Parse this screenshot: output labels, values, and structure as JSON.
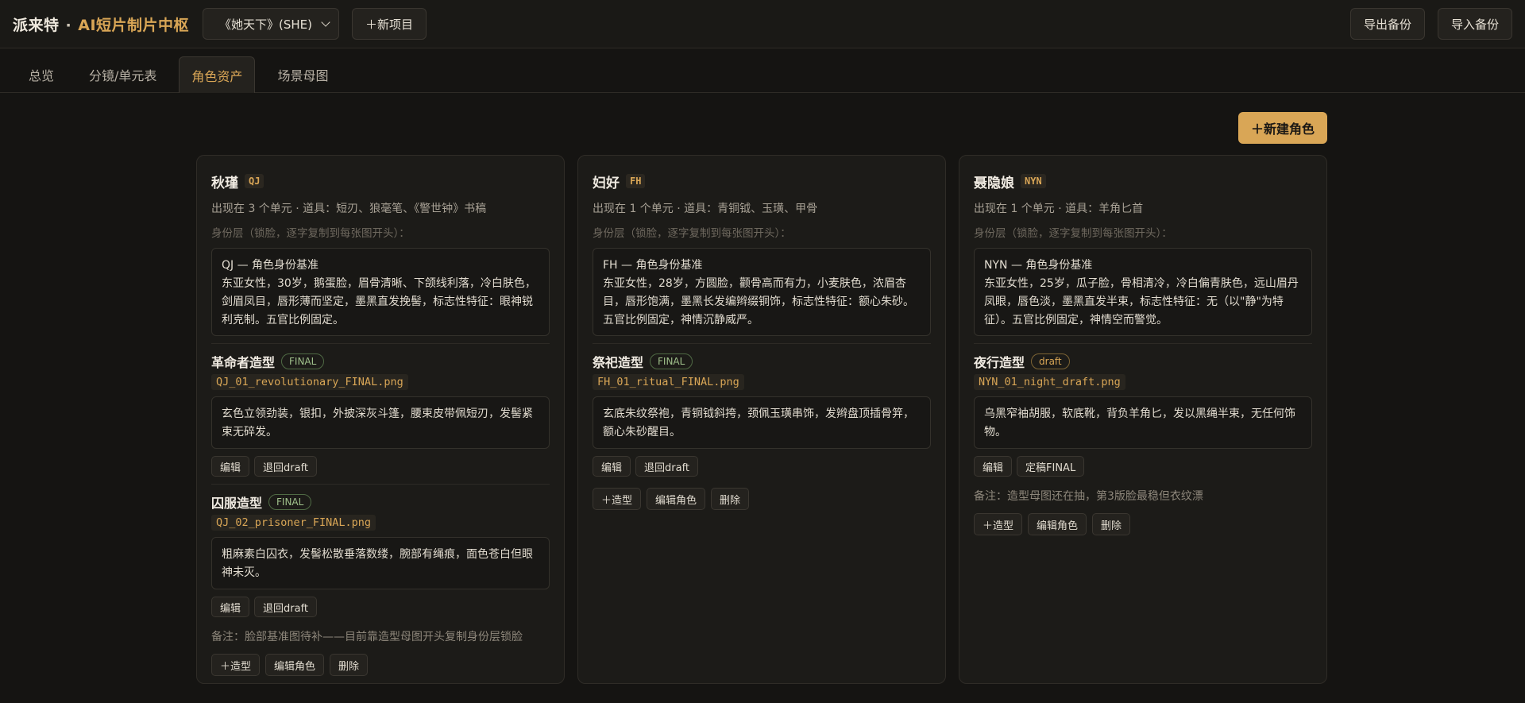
{
  "header": {
    "brand_name": "派来特",
    "brand_sep": "·",
    "brand_suffix": "AI短片制片中枢",
    "project": "《她天下》(SHE)",
    "new_project": "＋新项目",
    "export": "导出备份",
    "import": "导入备份"
  },
  "tabs": [
    {
      "label": "总览"
    },
    {
      "label": "分镜/单元表"
    },
    {
      "label": "角色资产"
    },
    {
      "label": "场景母图"
    }
  ],
  "toolbar": {
    "new_character": "＋新建角色"
  },
  "characters": [
    {
      "name": "秋瑾",
      "code": "QJ",
      "meta": "出现在 3 个单元 · 道具：短刃、狼毫笔、《警世钟》书稿",
      "hint": "身份层（锁脸，逐字复制到每张图开头）：",
      "identity_title": "QJ — 角色身份基准",
      "identity_body": "东亚女性，30岁，鹅蛋脸，眉骨清晰、下颌线利落，冷白肤色，剑眉凤目，唇形薄而坚定，墨黑直发挽髻，标志性特征：眼神锐利克制。五官比例固定。",
      "looks": [
        {
          "name": "革命者造型",
          "status": "FINAL",
          "file": "QJ_01_revolutionary_FINAL.png",
          "desc": "玄色立领劲装，银扣，外披深灰斗篷，腰束皮带佩短刃，发髻紧束无碎发。",
          "edit": "编辑",
          "toggle": "退回draft"
        },
        {
          "name": "囚服造型",
          "status": "FINAL",
          "file": "QJ_02_prisoner_FINAL.png",
          "desc": "粗麻素白囚衣，发髻松散垂落数缕，腕部有绳痕，面色苍白但眼神未灭。",
          "edit": "编辑",
          "toggle": "退回draft"
        }
      ],
      "note": "备注：脸部基准图待补——目前靠造型母图开头复制身份层锁脸",
      "add_look": "＋造型",
      "edit_char": "编辑角色",
      "delete": "删除"
    },
    {
      "name": "妇好",
      "code": "FH",
      "meta": "出现在 1 个单元 · 道具：青铜钺、玉璜、甲骨",
      "hint": "身份层（锁脸，逐字复制到每张图开头）：",
      "identity_title": "FH — 角色身份基准",
      "identity_body": "东亚女性，28岁，方圆脸，颧骨高而有力，小麦肤色，浓眉杏目，唇形饱满，墨黑长发编辫缀铜饰，标志性特征：额心朱砂。五官比例固定，神情沉静威严。",
      "looks": [
        {
          "name": "祭祀造型",
          "status": "FINAL",
          "file": "FH_01_ritual_FINAL.png",
          "desc": "玄底朱纹祭袍，青铜钺斜挎，颈佩玉璜串饰，发辫盘顶插骨笄，额心朱砂醒目。",
          "edit": "编辑",
          "toggle": "退回draft"
        }
      ],
      "note": "",
      "add_look": "＋造型",
      "edit_char": "编辑角色",
      "delete": "删除"
    },
    {
      "name": "聂隐娘",
      "code": "NYN",
      "meta": "出现在 1 个单元 · 道具：羊角匕首",
      "hint": "身份层（锁脸，逐字复制到每张图开头）：",
      "identity_title": "NYN — 角色身份基准",
      "identity_body": "东亚女性，25岁，瓜子脸，骨相清冷，冷白偏青肤色，远山眉丹凤眼，唇色淡，墨黑直发半束，标志性特征：无（以\"静\"为特征）。五官比例固定，神情空而警觉。",
      "looks": [
        {
          "name": "夜行造型",
          "status": "draft",
          "file": "NYN_01_night_draft.png",
          "desc": "乌黑窄袖胡服，软底靴，背负羊角匕，发以黑绳半束，无任何饰物。",
          "edit": "编辑",
          "toggle": "定稿FINAL"
        }
      ],
      "note": "备注：造型母图还在抽，第3版脸最稳但衣纹漂",
      "add_look": "＋造型",
      "edit_char": "编辑角色",
      "delete": "删除"
    }
  ]
}
